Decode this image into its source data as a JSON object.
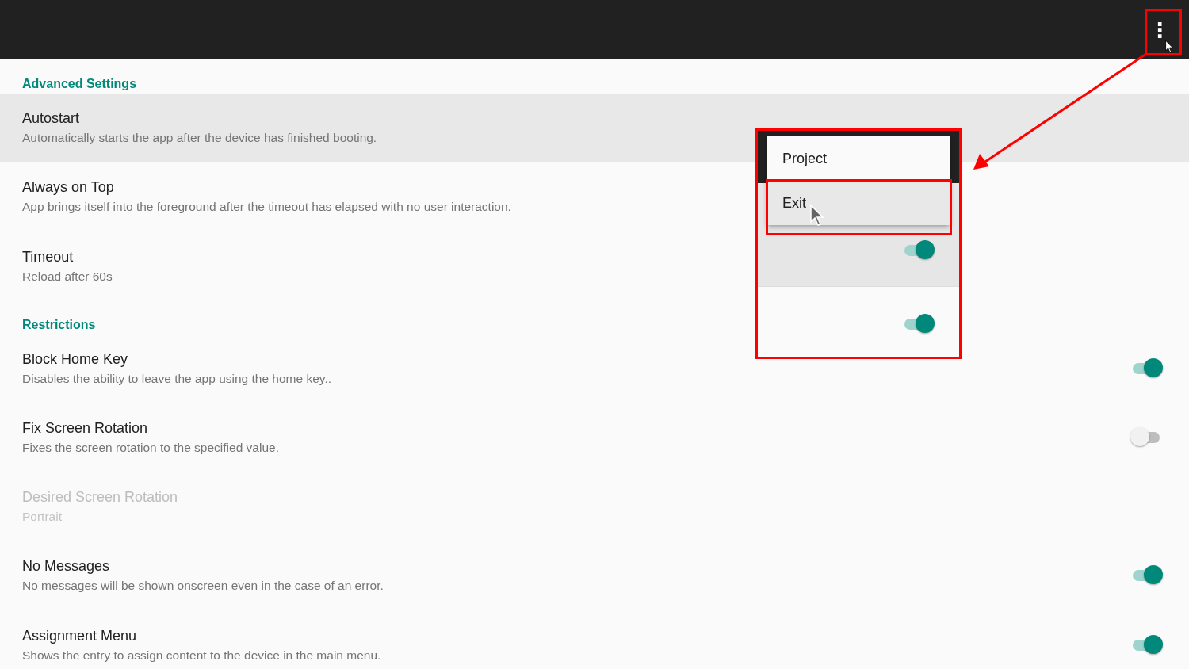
{
  "app_bar": {
    "menu_button": "⋮"
  },
  "sections": [
    {
      "title": "Advanced Settings",
      "items": [
        {
          "title": "Autostart",
          "subtitle": "Automatically starts the app after the device has finished booting.",
          "kind": "plain",
          "pressed": true,
          "disabled": false
        },
        {
          "title": "Always on Top",
          "subtitle": "App brings itself into the foreground after the timeout has elapsed with no user interaction.",
          "kind": "plain",
          "pressed": false,
          "disabled": false
        },
        {
          "title": "Timeout",
          "subtitle": "Reload after 60s",
          "kind": "plain",
          "pressed": false,
          "disabled": false
        }
      ]
    },
    {
      "title": "Restrictions",
      "items": [
        {
          "title": "Block Home Key",
          "subtitle": "Disables the ability to leave the app using the home key..",
          "kind": "toggle",
          "on": true,
          "pressed": false,
          "disabled": false
        },
        {
          "title": "Fix Screen Rotation",
          "subtitle": "Fixes the screen rotation to the specified value.",
          "kind": "toggle",
          "on": false,
          "pressed": false,
          "disabled": false
        },
        {
          "title": "Desired Screen Rotation",
          "subtitle": "Portrait",
          "kind": "plain",
          "pressed": false,
          "disabled": true
        },
        {
          "title": "No Messages",
          "subtitle": "No messages will be shown onscreen even in the case of an error.",
          "kind": "toggle",
          "on": true,
          "pressed": false,
          "disabled": false
        },
        {
          "title": "Assignment Menu",
          "subtitle": "Shows the entry to assign content to the device in the main menu.",
          "kind": "toggle",
          "on": true,
          "pressed": false,
          "disabled": false
        }
      ]
    }
  ],
  "callout": {
    "menu": [
      {
        "label": "Project",
        "selected": false
      },
      {
        "label": "Exit",
        "selected": true
      }
    ],
    "toggles": [
      {
        "on": true,
        "pressed": true
      },
      {
        "on": true,
        "pressed": false
      }
    ]
  }
}
